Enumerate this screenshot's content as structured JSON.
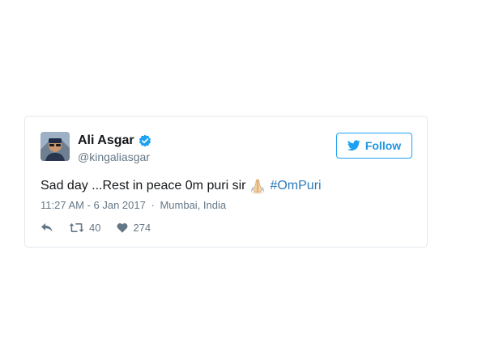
{
  "tweet": {
    "author": {
      "display_name": "Ali Asgar",
      "handle": "@kingaliasgar",
      "verified": true,
      "avatar_icon": "user-avatar"
    },
    "follow_button": {
      "label": "Follow",
      "icon": "twitter-bird-icon"
    },
    "text": {
      "body": "Sad day ...Rest in peace 0m puri sir",
      "emoji": "folded-hands",
      "hashtag": "#OmPuri"
    },
    "meta": {
      "time": "11:27 AM - 6 Jan 2017",
      "separator": "·",
      "location": "Mumbai, India"
    },
    "actions": {
      "reply_icon": "reply-icon",
      "retweet_icon": "retweet-icon",
      "retweet_count": "40",
      "like_icon": "heart-icon",
      "like_count": "274"
    }
  },
  "colors": {
    "twitter_blue": "#1da1f2",
    "link_blue": "#2b7bb9",
    "text_primary": "#14171a",
    "text_secondary": "#657786",
    "border": "#e1e8ed"
  }
}
